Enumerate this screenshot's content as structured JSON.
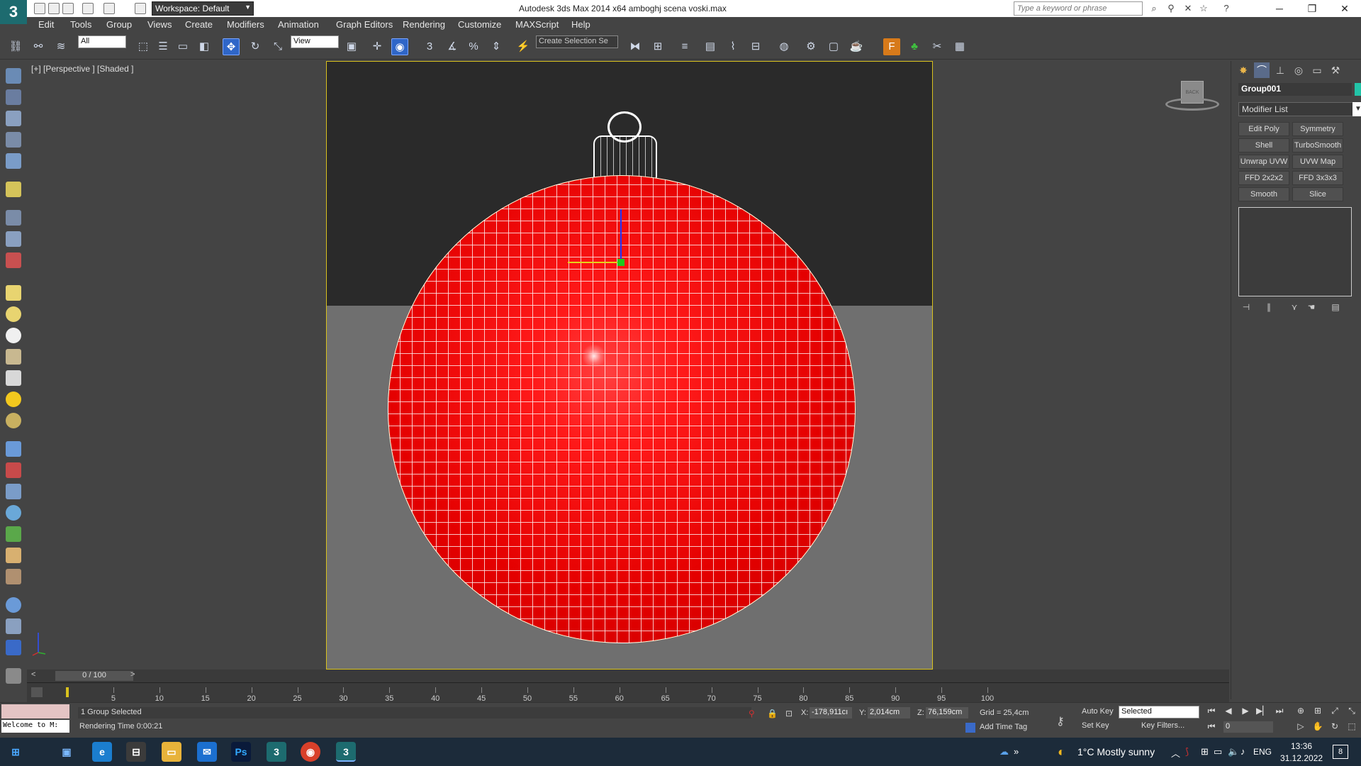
{
  "titlebar": {
    "logo": "3",
    "workspace": "Workspace: Default",
    "title": "Autodesk 3ds Max  2014 x64     amboghj  scena  voski.max",
    "search_placeholder": "Type a keyword or phrase"
  },
  "menu": [
    "Edit",
    "Tools",
    "Group",
    "Views",
    "Create",
    "Modifiers",
    "Animation",
    "Graph Editors",
    "Rendering",
    "Customize",
    "MAXScript",
    "Help"
  ],
  "toolbar": {
    "selection_filter": "All",
    "ref_coord": "View",
    "named_selection": "Create Selection Se"
  },
  "viewport": {
    "label": "[+] [Perspective ] [Shaded ]",
    "viewcube_face": "BACK"
  },
  "command_panel": {
    "object_name": "Group001",
    "object_color": "#22c4a8",
    "modifier_list": "Modifier List",
    "modifier_buttons": [
      "Edit Poly",
      "Symmetry",
      "Shell",
      "TurboSmooth",
      "Unwrap UVW",
      "UVW Map",
      "FFD 2x2x2",
      "FFD 3x3x3",
      "Smooth",
      "Slice"
    ]
  },
  "timeline": {
    "time_label": "0 / 100",
    "ticks": [
      "5",
      "10",
      "15",
      "20",
      "25",
      "30",
      "35",
      "40",
      "45",
      "50",
      "55",
      "60",
      "65",
      "70",
      "75",
      "80",
      "85",
      "90",
      "95",
      "100"
    ]
  },
  "status": {
    "maxscript_output": "Welcome to M:",
    "selection": "1 Group Selected",
    "render_time": "Rendering Time  0:00:21",
    "x_label": "X:",
    "x_value": "-178,911cı",
    "y_label": "Y:",
    "y_value": "2,014cm",
    "z_label": "Z:",
    "z_value": "76,159cm",
    "grid": "Grid = 25,4cm",
    "add_time_tag": "Add Time Tag",
    "auto_key": "Auto Key",
    "set_key": "Set Key",
    "key_mode": "Selected",
    "key_filters": "Key Filters...",
    "frame": "0"
  },
  "taskbar": {
    "weather": "1°C  Mostly sunny",
    "language": "ENG",
    "time": "13:36",
    "date": "31.12.2022",
    "notification_count": "8"
  }
}
